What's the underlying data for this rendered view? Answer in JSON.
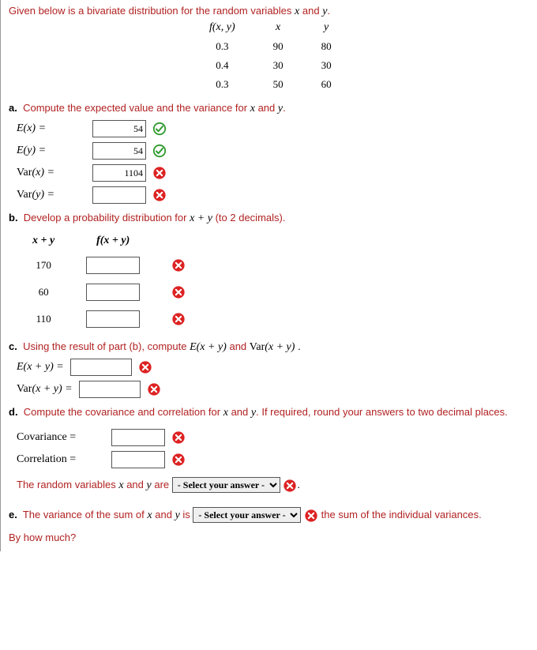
{
  "intro": "Given below is a bivariate distribution for the random variables",
  "and": "and",
  "dot": ".",
  "distTable": {
    "h1": "f(x, y)",
    "h2": "x",
    "h3": "y",
    "r": [
      [
        "0.3",
        "90",
        "80"
      ],
      [
        "0.4",
        "30",
        "30"
      ],
      [
        "0.3",
        "50",
        "60"
      ]
    ]
  },
  "a": {
    "prompt": "Compute the expected value and the variance for",
    "tail": "."
  },
  "labels": {
    "Ex": "E(x) =",
    "Ey": "E(y) =",
    "Varx": "Var(x) =",
    "Vary": "Var(y) =",
    "Exy": "E(x + y) =",
    "Varxy": "Var(x + y) =",
    "Cov": "Covariance =",
    "Corr": "Correlation ="
  },
  "vals": {
    "Ex": "54",
    "Ey": "54",
    "Varx": "1104",
    "Vary": "",
    "Exy": "",
    "Varxy": "",
    "Cov": "",
    "Corr": "",
    "b1": "",
    "b2": "",
    "b3": ""
  },
  "b": {
    "prompt": "Develop a probability distribution for",
    "tail": "(to 2 decimals).",
    "h1": "x + y",
    "h2": "f(x + y)",
    "rows": [
      "170",
      "60",
      "110"
    ]
  },
  "c": {
    "prompt": "Using the result of part (b), compute",
    "mid": "and",
    "tail": "."
  },
  "d": {
    "prompt": "Compute the covariance and correlation for",
    "tail": ". If required, round your answers to two decimal places."
  },
  "rv": {
    "pre": "The random variables",
    "mid": "are",
    "after": "."
  },
  "e": {
    "pre": "The variance of the sum of",
    "mid": "is",
    "after": "the sum of the individual variances."
  },
  "select": "- Select your answer -",
  "bywhy": "By how much?",
  "parts": {
    "a": "a.",
    "b": "b.",
    "c": "c.",
    "d": "d.",
    "e": "e."
  }
}
